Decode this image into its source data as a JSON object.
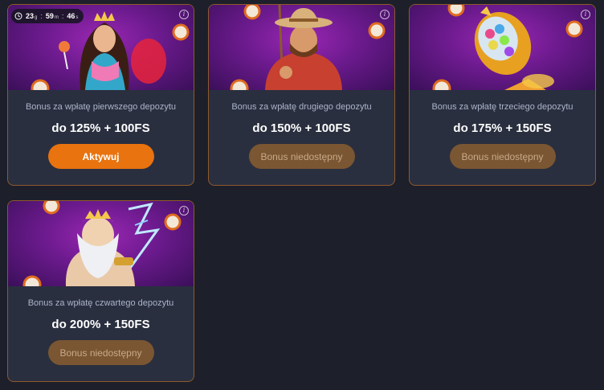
{
  "timer": {
    "days": "23",
    "days_unit": "g",
    "hours": "59",
    "hours_unit": "m",
    "seconds": "46",
    "seconds_unit": "s",
    "sep": ":"
  },
  "info_glyph": "i",
  "bonuses": [
    {
      "label": "Bonus za wpłatę pierwszego depozytu",
      "amount": "do 125% + 100FS",
      "button": "Aktywuj",
      "state": "active",
      "icon": "princess-illustration"
    },
    {
      "label": "Bonus za wpłatę drugiego depozytu",
      "amount": "do 150% + 100FS",
      "button": "Bonus niedostępny",
      "state": "disabled",
      "icon": "cowboy-illustration"
    },
    {
      "label": "Bonus za wpłatę trzeciego depozytu",
      "amount": "do 175% + 150FS",
      "button": "Bonus niedostępny",
      "state": "disabled",
      "icon": "gumball-rocket-illustration"
    },
    {
      "label": "Bonus za wpłatę czwartego depozytu",
      "amount": "do 200% + 150FS",
      "button": "Bonus niedostępny",
      "state": "disabled",
      "icon": "zeus-illustration"
    }
  ],
  "colors": {
    "page_bg": "#1d1f2b",
    "card_bg": "#2a2f3f",
    "card_border": "#8f5a2b",
    "button_active": "#e8730f",
    "button_disabled": "#7a5632"
  }
}
